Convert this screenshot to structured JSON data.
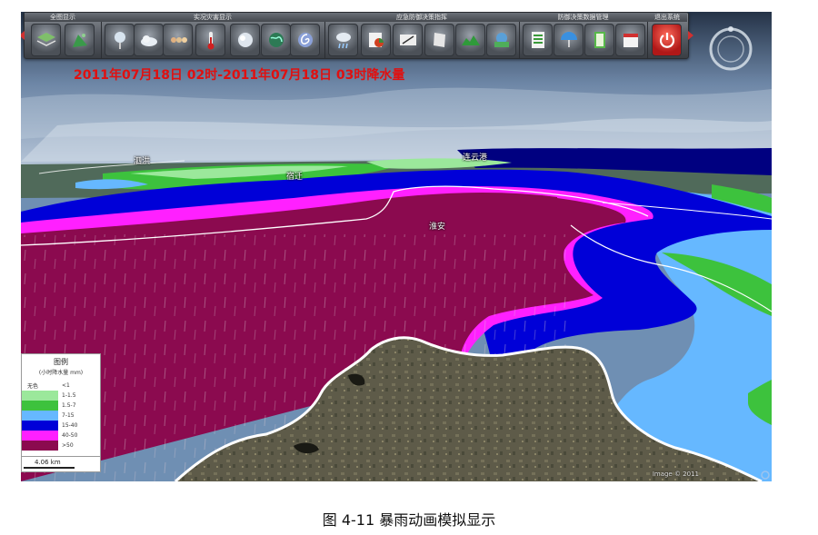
{
  "toolbar": {
    "groups": [
      {
        "label": "全图显示"
      },
      {
        "label": "实况灾害显示"
      },
      {
        "label": "应急防御决策指挥"
      },
      {
        "label": "防御决策数据管理"
      },
      {
        "label": "退出系统"
      }
    ],
    "buttons": [
      {
        "icon": "layers-icon"
      },
      {
        "icon": "terrain-icon"
      },
      {
        "icon": "weather-station-icon"
      },
      {
        "icon": "cloud-icon"
      },
      {
        "icon": "wind-icon"
      },
      {
        "icon": "thermometer-icon"
      },
      {
        "icon": "storm-cloud-icon"
      },
      {
        "icon": "globe-icon"
      },
      {
        "icon": "typhoon-icon"
      },
      {
        "icon": "rain-icon"
      },
      {
        "icon": "pie-chart-icon"
      },
      {
        "icon": "pen-icon"
      },
      {
        "icon": "document-icon"
      },
      {
        "icon": "mountain-chart-icon"
      },
      {
        "icon": "network-icon"
      },
      {
        "icon": "spreadsheet-icon"
      },
      {
        "icon": "umbrella-icon"
      },
      {
        "icon": "notebook-icon"
      },
      {
        "icon": "calendar-icon"
      },
      {
        "icon": "power-icon"
      }
    ]
  },
  "overlay_title": "2011年07月18日 02时-2011年07月18日 03时降水量",
  "places": [
    {
      "name": "泗洪"
    },
    {
      "name": "宿迁"
    },
    {
      "name": "连云港"
    },
    {
      "name": "淮安"
    }
  ],
  "legend": {
    "title": "图例",
    "unit": "(小时降水量 mm)",
    "rows": [
      {
        "name": "无色",
        "range": "<1",
        "color": "#ffffff"
      },
      {
        "name": "",
        "range": "1-1.5",
        "color": "#9be89b"
      },
      {
        "name": "",
        "range": "1.5-7",
        "color": "#3dc23d"
      },
      {
        "name": "",
        "range": "7-15",
        "color": "#66b8ff"
      },
      {
        "name": "",
        "range": "15-40",
        "color": "#0000d8"
      },
      {
        "name": "",
        "range": "40-50",
        "color": "#ff20ff"
      },
      {
        "name": "",
        "range": ">50",
        "color": "#8b0a4f"
      }
    ]
  },
  "scale_text": "4.06 km",
  "copyright": "Image © 2011",
  "caption": "图 4-11 暴雨动画模拟显示",
  "colors": {
    "sky_top": "#2e3f57",
    "sky_mid": "#8ea6c6",
    "rain_max": "#8b0a4f",
    "rain_magenta": "#ff20ff",
    "rain_blue": "#0000d8",
    "rain_light_blue": "#66b8ff",
    "rain_green": "#3dc23d",
    "rain_light_green": "#9be89b",
    "land": "#5c5a48",
    "title_red": "#e01010"
  }
}
